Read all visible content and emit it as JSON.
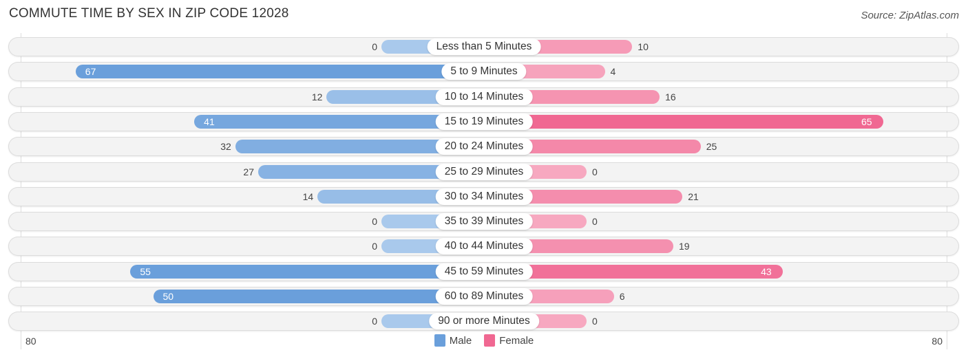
{
  "title": "COMMUTE TIME BY SEX IN ZIP CODE 12028",
  "source": "Source: ZipAtlas.com",
  "chart_data": {
    "type": "bar",
    "orientation": "horizontal-diverging",
    "title": "COMMUTE TIME BY SEX IN ZIP CODE 12028",
    "categories": [
      "Less than 5 Minutes",
      "5 to 9 Minutes",
      "10 to 14 Minutes",
      "15 to 19 Minutes",
      "20 to 24 Minutes",
      "25 to 29 Minutes",
      "30 to 34 Minutes",
      "35 to 39 Minutes",
      "40 to 44 Minutes",
      "45 to 59 Minutes",
      "60 to 89 Minutes",
      "90 or more Minutes"
    ],
    "series": [
      {
        "name": "Male",
        "color": "#6a9fdb",
        "light_color": "#a9c9ec",
        "values": [
          0,
          67,
          12,
          41,
          32,
          27,
          14,
          0,
          0,
          55,
          50,
          0
        ]
      },
      {
        "name": "Female",
        "color": "#f06892",
        "light_color": "#f7a8c0",
        "values": [
          10,
          4,
          16,
          65,
          25,
          0,
          21,
          0,
          19,
          43,
          6,
          0
        ]
      }
    ],
    "axis": {
      "left_label": "80",
      "right_label": "80",
      "range": [
        80,
        80
      ]
    },
    "legend": {
      "position": "bottom-center",
      "entries": [
        "Male",
        "Female"
      ]
    },
    "grid": false
  }
}
